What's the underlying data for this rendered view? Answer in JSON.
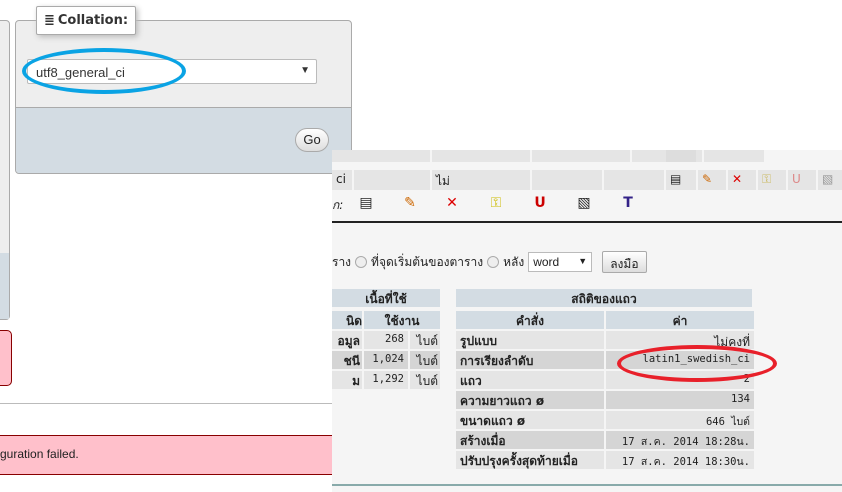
{
  "collation": {
    "legend": "Collation:",
    "selected": "utf8_general_ci",
    "go": "Go"
  },
  "error": {
    "text": "guration failed."
  },
  "structure": {
    "row_partial": "ci",
    "null_value": "ไม่",
    "with_selected": "ก:"
  },
  "insert": {
    "prefix": "ราง",
    "at_start": "ที่จุดเริ่มต้นของตาราง",
    "after": "หลัง",
    "after_field": "word",
    "go": "ลงมือ"
  },
  "space": {
    "title": "เนื้อที่ใช้",
    "col_type": "นิด",
    "col_usage": "ใช้งาน",
    "rows": [
      {
        "label": "อมูล",
        "value": "268",
        "unit": "ไบต์"
      },
      {
        "label": "ชนี",
        "value": "1,024",
        "unit": "ไบต์"
      },
      {
        "label": "ม",
        "value": "1,292",
        "unit": "ไบต์"
      }
    ]
  },
  "stats": {
    "title": "สถิติของแถว",
    "col_stmt": "คำสั่ง",
    "col_value": "ค่า",
    "rows": [
      {
        "label": "รูปแบบ",
        "value": "ไม่คงที่"
      },
      {
        "label": "การเรียงลำดับ",
        "value": "latin1_swedish_ci"
      },
      {
        "label": "แถว",
        "value": "2"
      },
      {
        "label": "ความยาวแถว ø",
        "value": "134"
      },
      {
        "label": "ขนาดแถว ø",
        "value": "646 ไบต์"
      },
      {
        "label": "สร้างเมื่อ",
        "value": "17 ส.ค. 2014 18:28น."
      },
      {
        "label": "ปรับปรุงครั้งสุดท้ายเมื่อ",
        "value": "17 ส.ค. 2014 18:30น."
      }
    ]
  },
  "colors": {
    "highlight_blue": "#0aa3e4",
    "highlight_red": "#e8202a",
    "header": "#d3dce3",
    "error_bg": "#ffc0cb"
  }
}
